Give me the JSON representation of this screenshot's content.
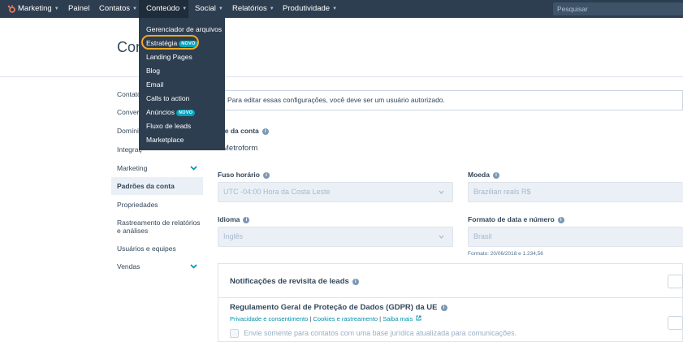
{
  "topnav": {
    "brand": "Marketing",
    "items": [
      "Painel",
      "Contatos",
      "Conteúdo",
      "Social",
      "Relatórios",
      "Produtividade"
    ],
    "search_placeholder": "Pesquisar"
  },
  "page": {
    "title": "Con"
  },
  "dropdown": {
    "items": [
      {
        "label": "Gerenciador de arquivos"
      },
      {
        "label": "Estratégia",
        "badge": "NOVO"
      },
      {
        "label": "Landing Pages"
      },
      {
        "label": "Blog"
      },
      {
        "label": "Email"
      },
      {
        "label": "Calls to action"
      },
      {
        "label": "Anúncios",
        "badge": "NOVO"
      },
      {
        "label": "Fluxo de leads"
      },
      {
        "label": "Marketplace"
      }
    ]
  },
  "sidebar": {
    "items": [
      {
        "label": "Contato"
      },
      {
        "label": "Conver"
      },
      {
        "label": "Domíni"
      },
      {
        "label": "Integraç"
      },
      {
        "label": "Marketing"
      },
      {
        "label": "Padrões da conta"
      },
      {
        "label": "Propriedades"
      },
      {
        "label": "Rastreamento de relatórios"
      },
      {
        "label": "e análises"
      },
      {
        "label": "Usuários e equipes"
      },
      {
        "label": "Vendas"
      }
    ]
  },
  "notice": {
    "text": "Para editar essas configurações, você deve ser um usuário autorizado."
  },
  "account": {
    "name_label": "ome da conta",
    "name_value": "Metroform",
    "timezone_label": "Fuso horário",
    "timezone_value": "UTC -04:00 Hora da Costa Leste",
    "currency_label": "Moeda",
    "currency_value": "Brazilian reals R$",
    "language_label": "Idioma",
    "language_value": "Inglês",
    "format_label": "Formato de data e número",
    "format_value": "Brasil",
    "format_help": "Formato: 20/06/2018 e 1.234,56"
  },
  "leads_card": {
    "title": "Notificações de revisita de leads"
  },
  "gdpr_card": {
    "title": "Regulamento Geral de Proteção de Dados (GDPR) da UE",
    "link1": "Privacidade e consentimento",
    "sep": "|",
    "link2": "Cookies e rastreamento",
    "link3": "Saiba mais",
    "checkbox_label": "Envie somente para contatos com uma base jurídica atualizada para comunicações."
  }
}
